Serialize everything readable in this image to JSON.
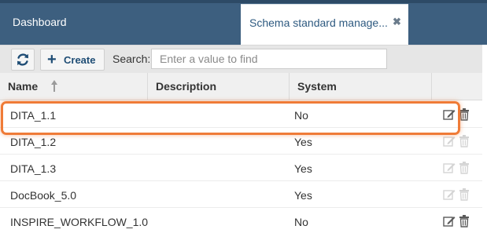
{
  "tabs": {
    "dashboard_label": "Dashboard",
    "active_label": "Schema standard manage...",
    "close_glyph": "✖"
  },
  "toolbar": {
    "refresh_icon": "refresh-icon",
    "create_icon": "plus-icon",
    "create_label": "Create",
    "search_label": "Search:",
    "search_placeholder": "Enter a value to find",
    "search_value": ""
  },
  "table": {
    "columns": [
      {
        "label": "Name",
        "sort": "ascending"
      },
      {
        "label": "Description"
      },
      {
        "label": "System"
      },
      {
        "label": ""
      }
    ],
    "rows": [
      {
        "name": "DITA_1.1",
        "description": "",
        "system": "No",
        "actions_enabled": true
      },
      {
        "name": "DITA_1.2",
        "description": "",
        "system": "Yes",
        "actions_enabled": false
      },
      {
        "name": "DITA_1.3",
        "description": "",
        "system": "Yes",
        "actions_enabled": false
      },
      {
        "name": "DocBook_5.0",
        "description": "",
        "system": "Yes",
        "actions_enabled": false
      },
      {
        "name": "INSPIRE_WORKFLOW_1.0",
        "description": "",
        "system": "No",
        "actions_enabled": true
      }
    ]
  },
  "colors": {
    "header_bar": "#3d5f7f",
    "highlight": "#ef7b37",
    "icon_enabled": "#5a5a5a",
    "icon_disabled": "#d4d4d4"
  }
}
